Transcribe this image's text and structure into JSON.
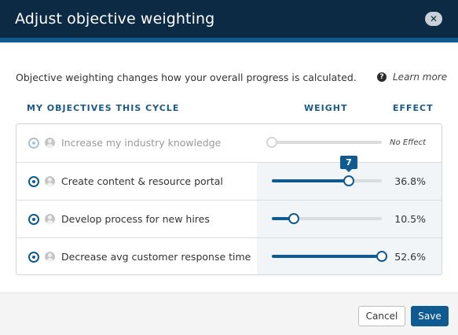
{
  "dialog": {
    "title": "Adjust objective weighting",
    "close_icon": "close-icon"
  },
  "intro": {
    "text": "Objective weighting changes how your overall progress is calculated.",
    "help_icon": "question-circle-icon",
    "learn_more": "Learn more"
  },
  "table": {
    "headers": {
      "objectives": "MY OBJECTIVES THIS CYCLE",
      "weight": "WEIGHT",
      "effect": "EFFECT"
    },
    "rows": [
      {
        "label": "Increase my industry knowledge",
        "effect": "No Effect",
        "weight": 0,
        "disabled": true
      },
      {
        "label": "Create content & resource portal",
        "effect": "36.8%",
        "weight": 7,
        "tooltip": "7",
        "disabled": false
      },
      {
        "label": "Develop process for new hires",
        "effect": "10.5%",
        "weight": 2,
        "disabled": false
      },
      {
        "label": "Decrease avg customer response time",
        "effect": "52.6%",
        "weight": 10,
        "disabled": false
      }
    ],
    "weight_max": 10
  },
  "footer": {
    "cancel_label": "Cancel",
    "save_label": "Save"
  },
  "colors": {
    "header_bg": "#0d2a44",
    "accent": "#0e5a91",
    "column_header": "#1a5a8a"
  }
}
